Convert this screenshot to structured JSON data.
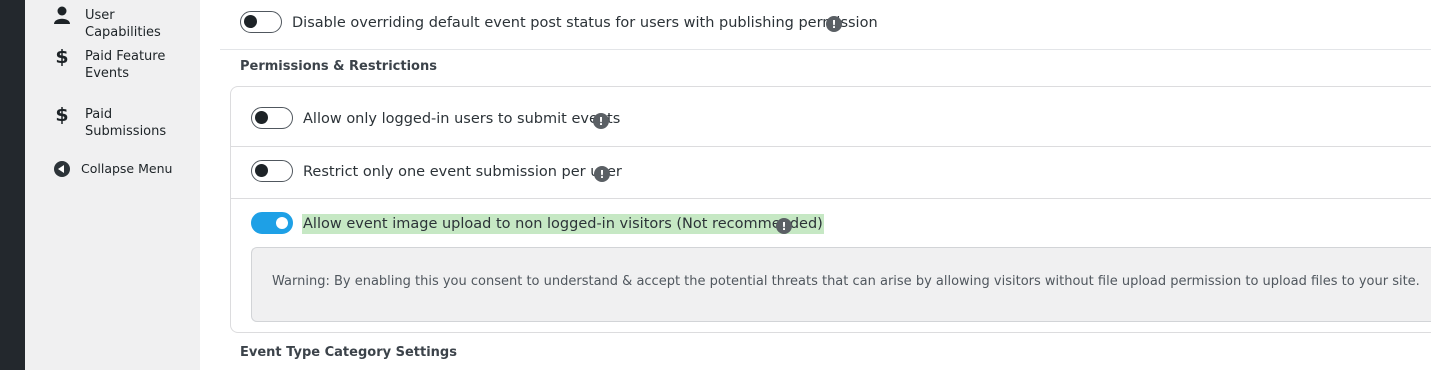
{
  "sidebar": {
    "items": [
      {
        "label": "User Capabilities",
        "icon": "person-icon"
      },
      {
        "label": "Paid Feature Events",
        "icon": "dollar-icon"
      },
      {
        "label": "Paid Submissions",
        "icon": "dollar-icon"
      },
      {
        "label": "Collapse Menu",
        "icon": "collapse-arrow-icon"
      }
    ]
  },
  "main": {
    "top_option": {
      "label": "Disable overriding default event post status for users with publishing permission",
      "enabled": false
    },
    "permissions_title": "Permissions & Restrictions",
    "permissions": [
      {
        "label": "Allow only logged-in users to submit events",
        "enabled": false
      },
      {
        "label": "Restrict only one event submission per user",
        "enabled": false
      },
      {
        "label": "Allow event image upload to non logged-in visitors (Not recommended)",
        "enabled": true
      }
    ],
    "warning_text": "Warning: By enabling this you consent to understand & accept the potential threats that can arise by allowing visitors without file upload permission to upload files to your site.",
    "next_section_title": "Event Type Category Settings",
    "info_glyph": "!"
  },
  "colors": {
    "toggle_on": "#1ea0e6",
    "highlight": "#c6e8c4",
    "sidebar_bg": "#f0f0f1",
    "dark_strip": "#23282d"
  }
}
